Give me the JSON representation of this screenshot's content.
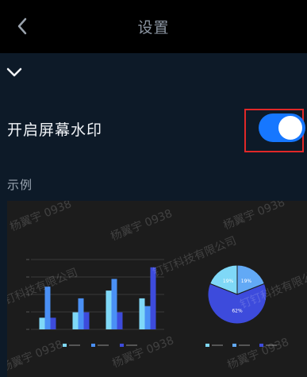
{
  "header": {
    "title": "设置",
    "back_icon": "chevron-left-icon"
  },
  "section": {
    "collapse_icon": "chevron-down-icon"
  },
  "watermark_setting": {
    "label": "开启屏幕水印",
    "enabled": true
  },
  "example": {
    "label": "示例"
  },
  "watermark": {
    "texts": [
      "杨翼宇 0938",
      "钉钉科技有限公司"
    ]
  },
  "colors": {
    "toggle_on": "#1677ff",
    "highlight": "#e02828",
    "series_light": "#7fd8f7",
    "series_mid": "#4a90f5",
    "series_dark": "#3d4bdc"
  },
  "chart_data": [
    {
      "type": "bar",
      "categories": [
        "",
        "",
        "",
        ""
      ],
      "series": [
        {
          "values": [
            15,
            22,
            50,
            40
          ]
        },
        {
          "values": [
            55,
            40,
            65,
            30
          ]
        },
        {
          "values": [
            15,
            22,
            22,
            80
          ]
        }
      ]
    },
    {
      "type": "pie",
      "slices": [
        {
          "label": "19%",
          "value": 19
        },
        {
          "label": "19%",
          "value": 19
        },
        {
          "label": "62%",
          "value": 62
        }
      ]
    }
  ]
}
